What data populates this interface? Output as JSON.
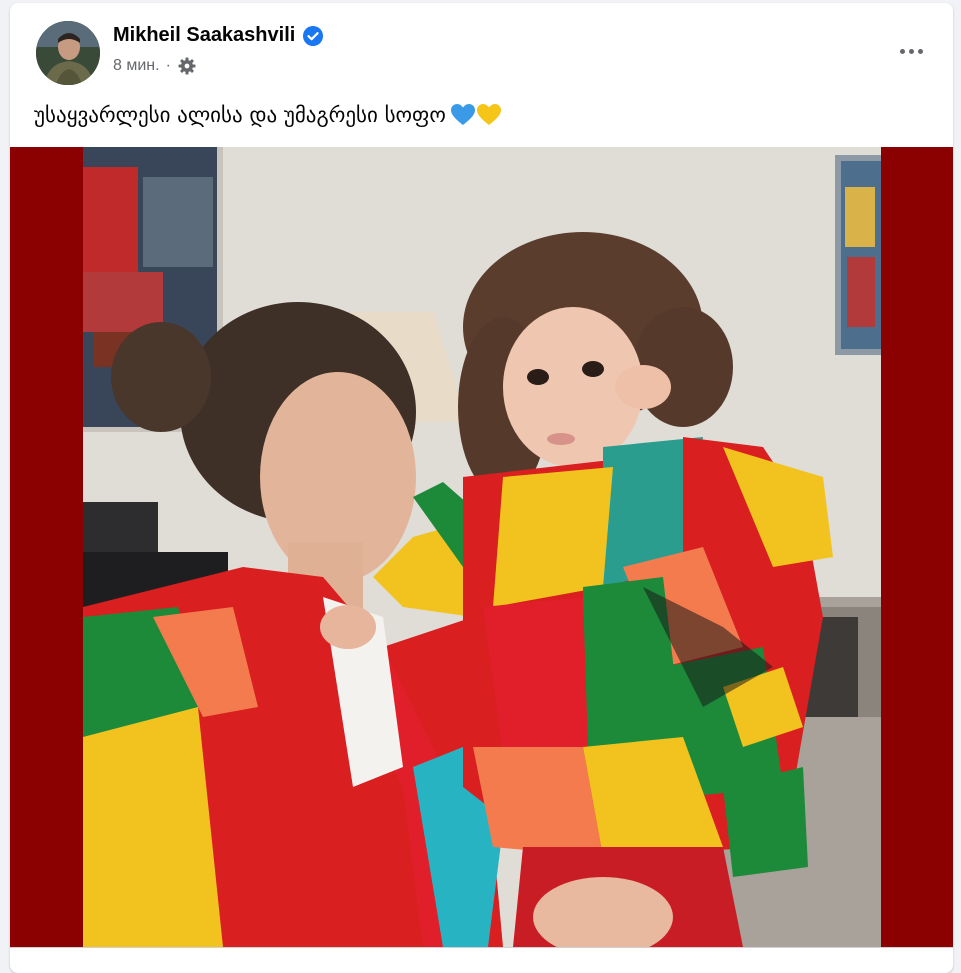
{
  "post": {
    "author": "Mikheil Saakashvili",
    "time": "8 мин.",
    "separator": "·",
    "caption": "უსაყვარლესი ალისა და უმაგრესი სოფო",
    "caption_emojis": [
      "blue-heart",
      "yellow-heart"
    ],
    "audience_icon": "gear-icon",
    "verified": true
  },
  "colors": {
    "verified_blue": "#1877f2",
    "photo_frame": "#8b0000",
    "meta_gray": "#65676b",
    "blue_heart": "#3b9ae8",
    "yellow_heart": "#f5c518"
  }
}
